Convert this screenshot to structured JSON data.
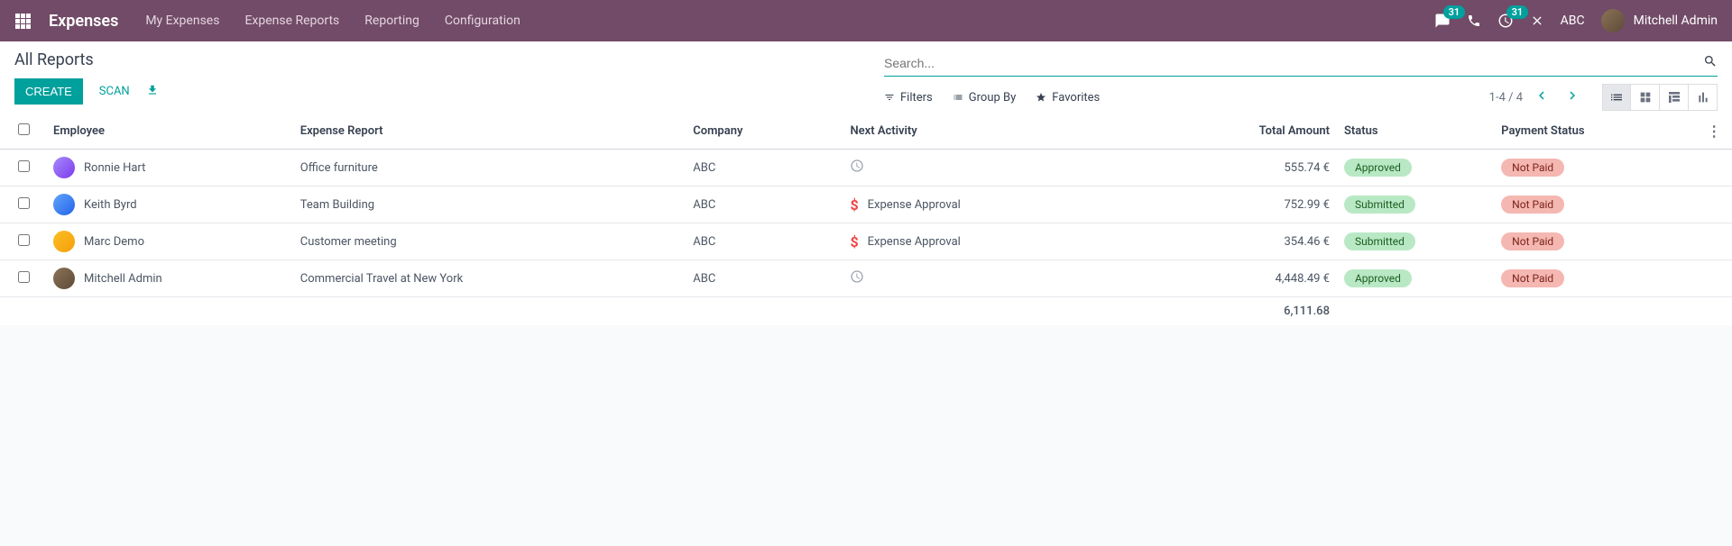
{
  "navbar": {
    "brand": "Expenses",
    "menu": [
      "My Expenses",
      "Expense Reports",
      "Reporting",
      "Configuration"
    ],
    "messages_badge": "31",
    "activities_badge": "31",
    "company": "ABC",
    "user": "Mitchell Admin"
  },
  "page": {
    "title": "All Reports",
    "create": "CREATE",
    "scan": "SCAN"
  },
  "search": {
    "placeholder": "Search...",
    "filters": "Filters",
    "groupby": "Group By",
    "favorites": "Favorites",
    "pager": "1-4 / 4"
  },
  "columns": {
    "employee": "Employee",
    "report": "Expense Report",
    "company": "Company",
    "activity": "Next Activity",
    "amount": "Total Amount",
    "status": "Status",
    "payment": "Payment Status"
  },
  "rows": [
    {
      "employee": "Ronnie Hart",
      "report": "Office furniture",
      "company": "ABC",
      "activity_type": "clock",
      "activity_text": "",
      "amount": "555.74 €",
      "status": "Approved",
      "status_class": "approved",
      "payment": "Not Paid",
      "avatar": "c1"
    },
    {
      "employee": "Keith Byrd",
      "report": "Team Building",
      "company": "ABC",
      "activity_type": "dollar",
      "activity_text": "Expense Approval",
      "amount": "752.99 €",
      "status": "Submitted",
      "status_class": "submitted",
      "payment": "Not Paid",
      "avatar": "c2"
    },
    {
      "employee": "Marc Demo",
      "report": "Customer meeting",
      "company": "ABC",
      "activity_type": "dollar",
      "activity_text": "Expense Approval",
      "amount": "354.46 €",
      "status": "Submitted",
      "status_class": "submitted",
      "payment": "Not Paid",
      "avatar": "c3"
    },
    {
      "employee": "Mitchell Admin",
      "report": "Commercial Travel at New York",
      "company": "ABC",
      "activity_type": "clock",
      "activity_text": "",
      "amount": "4,448.49 €",
      "status": "Approved",
      "status_class": "approved",
      "payment": "Not Paid",
      "avatar": "c4"
    }
  ],
  "total": "6,111.68"
}
